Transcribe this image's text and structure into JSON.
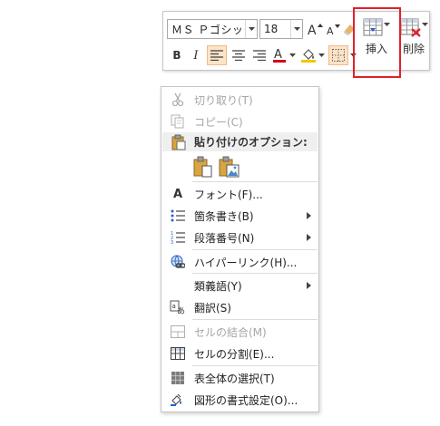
{
  "toolbar": {
    "font_name": "ＭＳ Ｐゴシック ﾈ",
    "font_size": "18",
    "insert_label": "挿入",
    "delete_label": "削除"
  },
  "menu": {
    "cut": "切り取り(T)",
    "copy": "コピー(C)",
    "paste_options": "貼り付けのオプション:",
    "font": "フォント(F)...",
    "bullets": "箇条書き(B)",
    "numbering": "段落番号(N)",
    "hyperlink": "ハイパーリンク(H)...",
    "synonyms": "類義語(Y)",
    "translate": "翻訳(S)",
    "merge_cells": "セルの結合(M)",
    "split_cells": "セルの分割(E)...",
    "select_table": "表全体の選択(T)",
    "format_shape": "図形の書式設定(O)..."
  }
}
